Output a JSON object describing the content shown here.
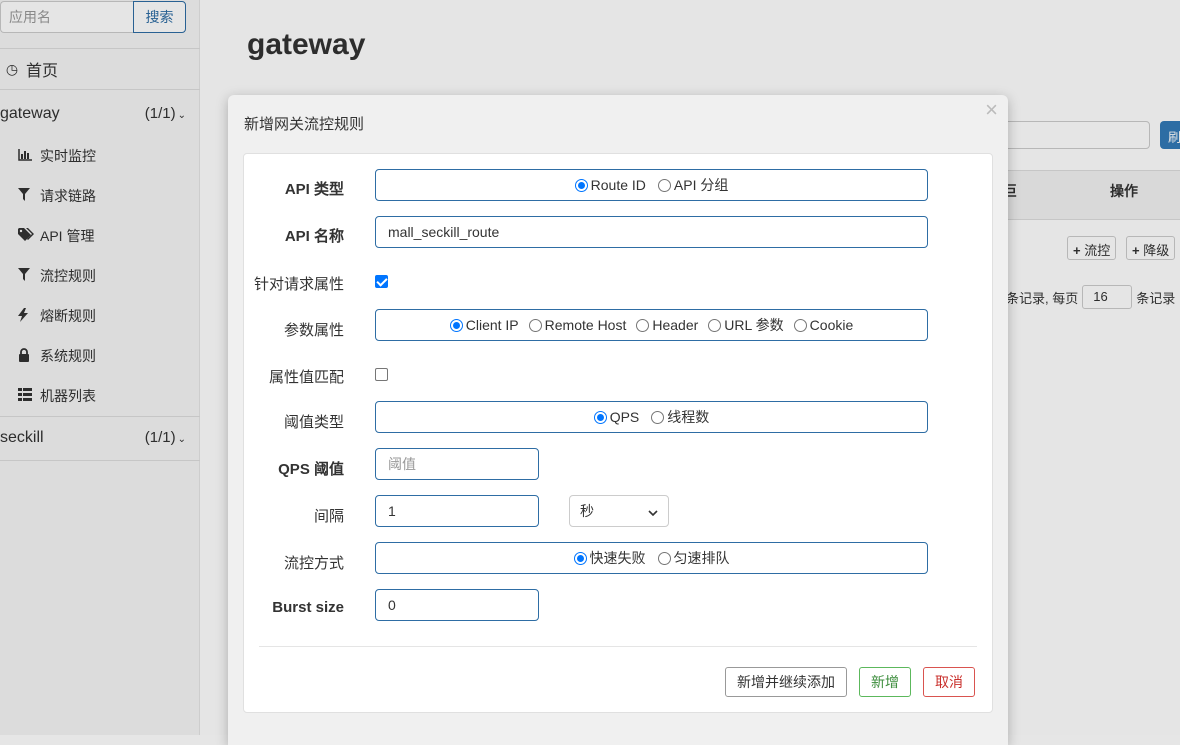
{
  "sidebar": {
    "search": {
      "placeholder": "应用名",
      "button": "搜索"
    },
    "home": {
      "icon": "dashboard-icon",
      "label": "首页"
    },
    "apps": [
      {
        "name": "gateway",
        "count": "(1/1)"
      },
      {
        "name": "seckill",
        "count": "(1/1)"
      }
    ],
    "menu": [
      {
        "icon": "bar-chart-icon",
        "label": "实时监控"
      },
      {
        "icon": "filter-icon",
        "label": "请求链路"
      },
      {
        "icon": "tags-icon",
        "label": "API 管理"
      },
      {
        "icon": "filter-icon",
        "label": "流控规则"
      },
      {
        "icon": "flash-icon",
        "label": "熔断规则"
      },
      {
        "icon": "lock-icon",
        "label": "系统规则"
      },
      {
        "icon": "list-icon",
        "label": "机器列表"
      }
    ]
  },
  "main": {
    "title": "gateway",
    "table": {
      "col_partial": "巨",
      "col_actions": "操作"
    },
    "row_buttons": {
      "flow": "流控",
      "degrade": "降级"
    },
    "refresh_button_partial": "刷",
    "pager": {
      "prefix": "条记录, 每页",
      "page_size": "16",
      "suffix": "条记录"
    }
  },
  "modal": {
    "title": "新增网关流控规则",
    "close": "×",
    "fields": {
      "api_type": {
        "label": "API 类型",
        "options": [
          "Route ID",
          "API 分组"
        ],
        "selected": 0
      },
      "api_name": {
        "label": "API 名称",
        "value": "mall_seckill_route"
      },
      "per_request_attr": {
        "label": "针对请求属性",
        "checked": true
      },
      "param_attr": {
        "label": "参数属性",
        "options": [
          "Client IP",
          "Remote Host",
          "Header",
          "URL 参数",
          "Cookie"
        ],
        "selected": 0
      },
      "attr_match": {
        "label": "属性值匹配",
        "checked": false
      },
      "threshold_type": {
        "label": "阈值类型",
        "options": [
          "QPS",
          "线程数"
        ],
        "selected": 0
      },
      "qps_threshold": {
        "label": "QPS 阈值",
        "placeholder": "阈值",
        "value": ""
      },
      "interval": {
        "label": "间隔",
        "value": "1",
        "unit": "秒"
      },
      "control_behavior": {
        "label": "流控方式",
        "options": [
          "快速失败",
          "匀速排队"
        ],
        "selected": 0
      },
      "burst_size": {
        "label": "Burst size",
        "value": "0"
      }
    },
    "buttons": {
      "add_continue": "新增并继续添加",
      "add": "新增",
      "cancel": "取消"
    }
  },
  "colors": {
    "primary_border": "#2e6da4",
    "radio_checked": "#0075ff",
    "success": "#5cb85c",
    "danger": "#d9534f"
  }
}
